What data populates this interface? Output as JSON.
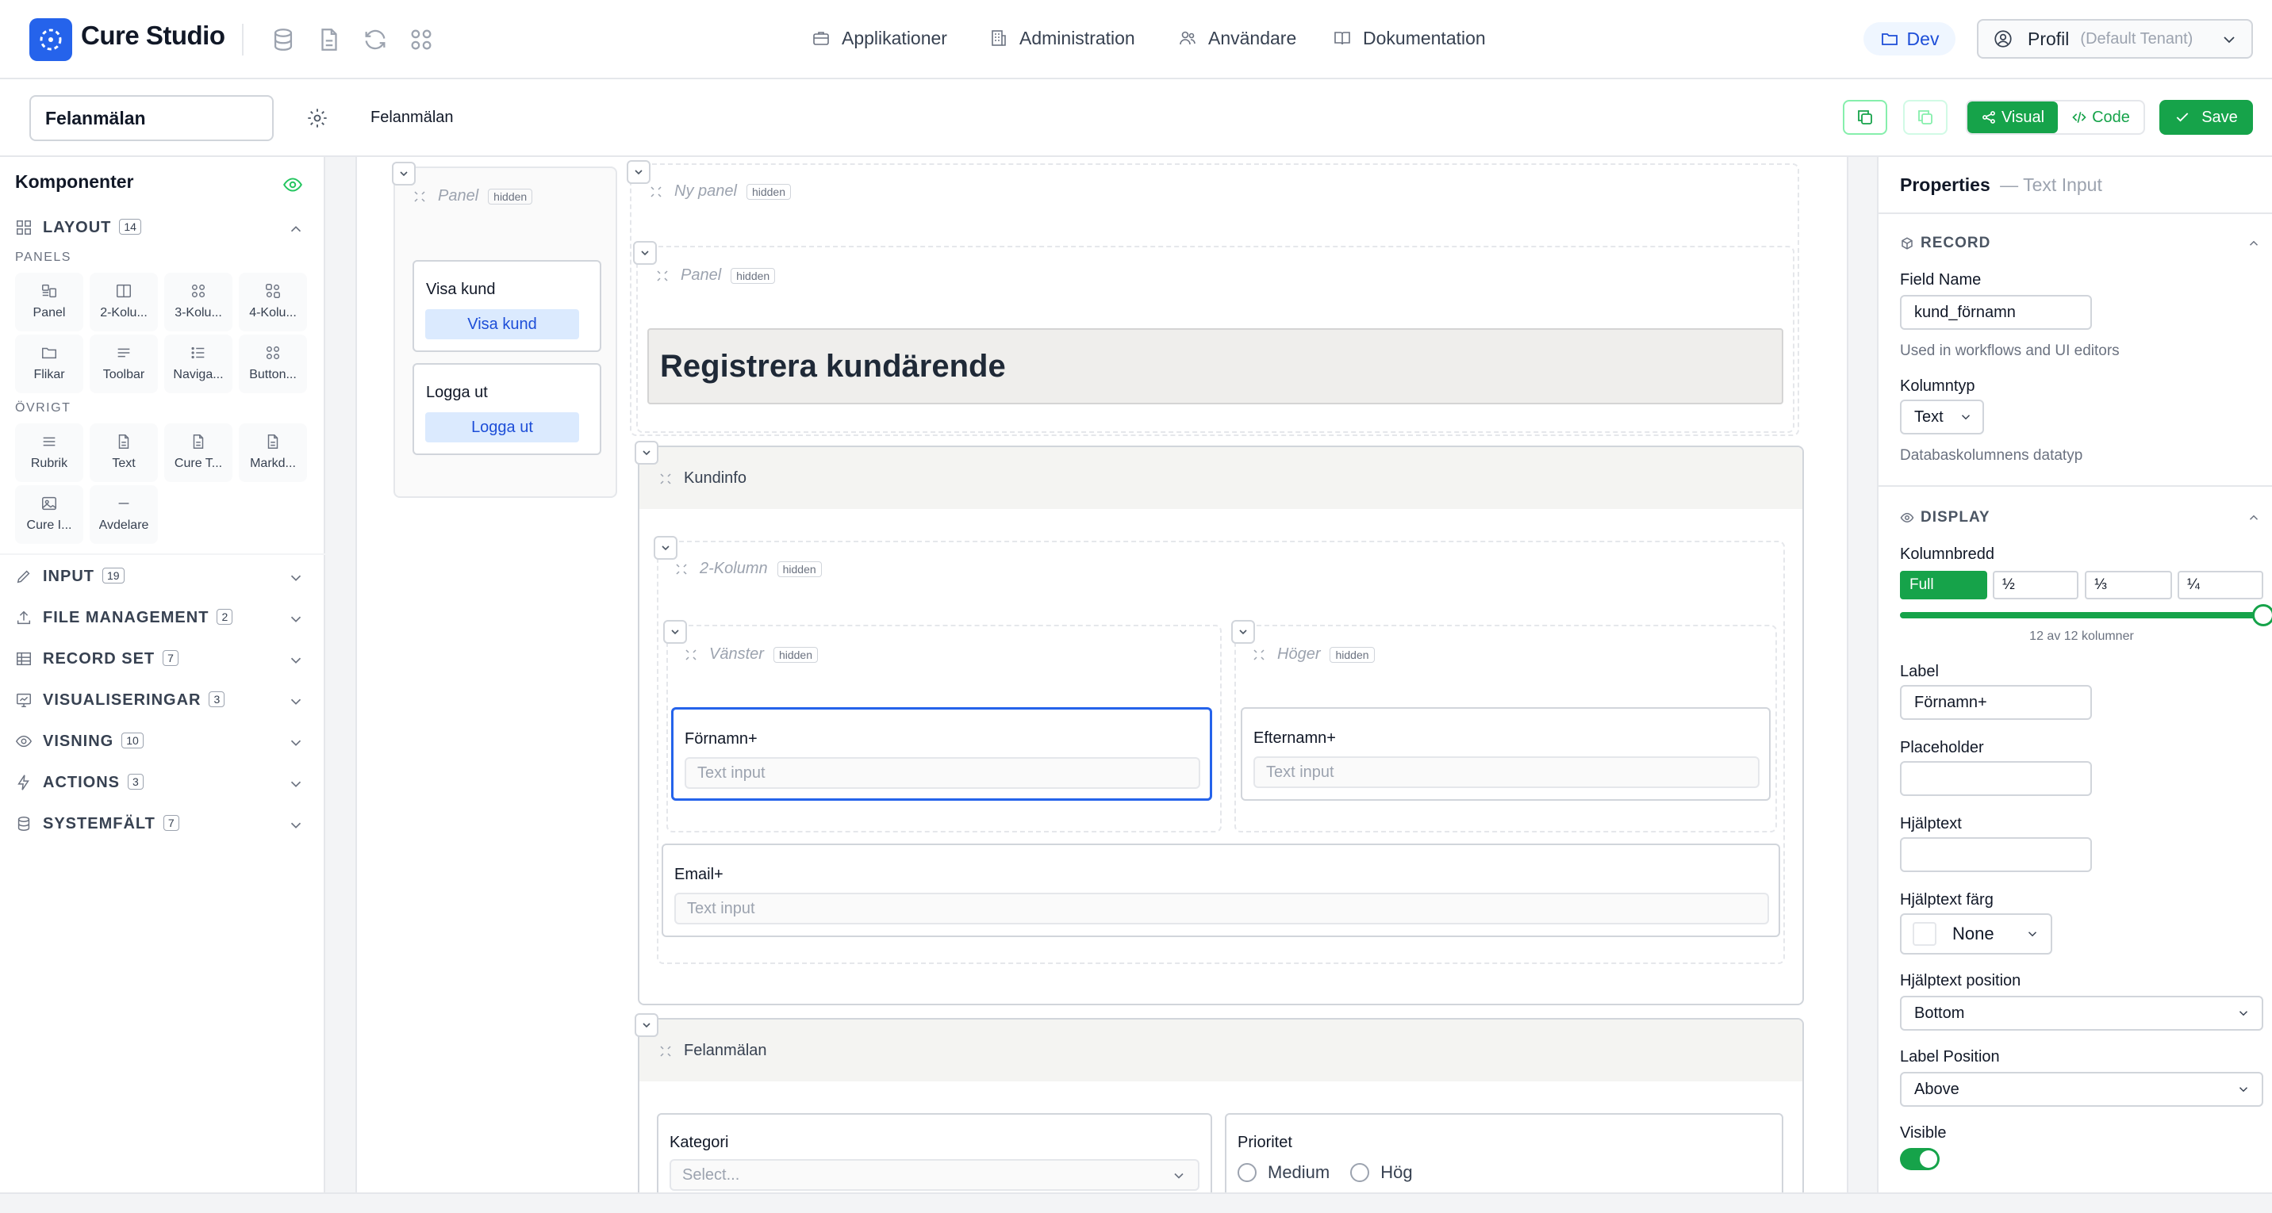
{
  "app": {
    "name": "Cure Studio"
  },
  "nav": {
    "items": [
      {
        "label": "Applikationer"
      },
      {
        "label": "Administration"
      },
      {
        "label": "Användare"
      },
      {
        "label": "Dokumentation"
      }
    ],
    "env_label": "Dev",
    "profile_label": "Profil",
    "profile_tenant": "(Default Tenant)"
  },
  "toolbar": {
    "page_name_value": "Felanmälan",
    "breadcrumb": "Felanmälan",
    "visual_label": "Visual",
    "code_label": "Code",
    "save_label": "Save"
  },
  "sidebar": {
    "title": "Komponenter",
    "sections": [
      {
        "label": "LAYOUT",
        "count": "14"
      },
      {
        "label": "INPUT",
        "count": "19"
      },
      {
        "label": "FILE MANAGEMENT",
        "count": "2"
      },
      {
        "label": "RECORD SET",
        "count": "7"
      },
      {
        "label": "VISUALISERINGAR",
        "count": "3"
      },
      {
        "label": "VISNING",
        "count": "10"
      },
      {
        "label": "ACTIONS",
        "count": "3"
      },
      {
        "label": "SYSTEMFÄLT",
        "count": "7"
      }
    ],
    "group_panels": "PANELS",
    "group_other": "ÖVRIGT",
    "panel_tiles": [
      {
        "label": "Panel",
        "icon": "panel-icon"
      },
      {
        "label": "2-Kolu...",
        "icon": "columns-icon"
      },
      {
        "label": "3-Kolu...",
        "icon": "grid-icon"
      },
      {
        "label": "4-Kolu...",
        "icon": "grid-four-icon"
      },
      {
        "label": "Flikar",
        "icon": "folder-icon"
      },
      {
        "label": "Toolbar",
        "icon": "toolbar-icon"
      },
      {
        "label": "Naviga...",
        "icon": "list-icon"
      },
      {
        "label": "Button...",
        "icon": "grid-icon"
      }
    ],
    "other_tiles": [
      {
        "label": "Rubrik",
        "icon": "heading-icon"
      },
      {
        "label": "Text",
        "icon": "file-icon"
      },
      {
        "label": "Cure T...",
        "icon": "file-icon"
      },
      {
        "label": "Markd...",
        "icon": "file-icon"
      },
      {
        "label": "Cure I...",
        "icon": "image-icon"
      },
      {
        "label": "Avdelare",
        "icon": "divider-icon"
      }
    ]
  },
  "canvas": {
    "left_panel_label": "Panel",
    "hidden_tag": "hidden",
    "card1_label": "Visa kund",
    "card1_button": "Visa kund",
    "card2_label": "Logga ut",
    "card2_button": "Logga ut",
    "new_panel_label": "Ny panel",
    "inner_panel_label": "Panel",
    "heading": "Registrera kundärende",
    "kundinfo_header": "Kundinfo",
    "two_col_label": "2-Kolumn",
    "left_col_label": "Vänster",
    "right_col_label": "Höger",
    "field_firstname_label": "Förnamn+",
    "field_lastname_label": "Efternamn+",
    "field_email_label": "Email+",
    "text_input_placeholder": "Text input",
    "felanmalan_header": "Felanmälan",
    "kategori_label": "Kategori",
    "kategori_placeholder": "Select...",
    "prioritet_label": "Prioritet",
    "prioritet_options": [
      "Medium",
      "Hög"
    ]
  },
  "properties": {
    "title": "Properties",
    "subtitle": "— Text Input",
    "record_section": "RECORD",
    "field_name_label": "Field Name",
    "field_name_value": "kund_förnamn",
    "field_name_help": "Used in workflows and UI editors",
    "kolumntyp_label": "Kolumntyp",
    "kolumntyp_value": "Text",
    "kolumntyp_help": "Databaskolumnens datatyp",
    "display_section": "DISPLAY",
    "kolumnbredd_label": "Kolumnbredd",
    "width_options": [
      "Full",
      "½",
      "⅓",
      "¼"
    ],
    "width_slider_value": 12,
    "width_slider_max": 12,
    "width_caption": "12 av 12 kolumner",
    "label_label": "Label",
    "label_value": "Förnamn+",
    "placeholder_label": "Placeholder",
    "placeholder_value": "",
    "helptext_label": "Hjälptext",
    "helptext_value": "",
    "helpcolor_label": "Hjälptext färg",
    "helpcolor_value": "None",
    "helppos_label": "Hjälptext position",
    "helppos_value": "Bottom",
    "labelpos_label": "Label Position",
    "labelpos_value": "Above",
    "visible_label": "Visible",
    "visible_on": true
  },
  "colors": {
    "brand": "#2563eb",
    "accent_green": "#16a34a"
  }
}
